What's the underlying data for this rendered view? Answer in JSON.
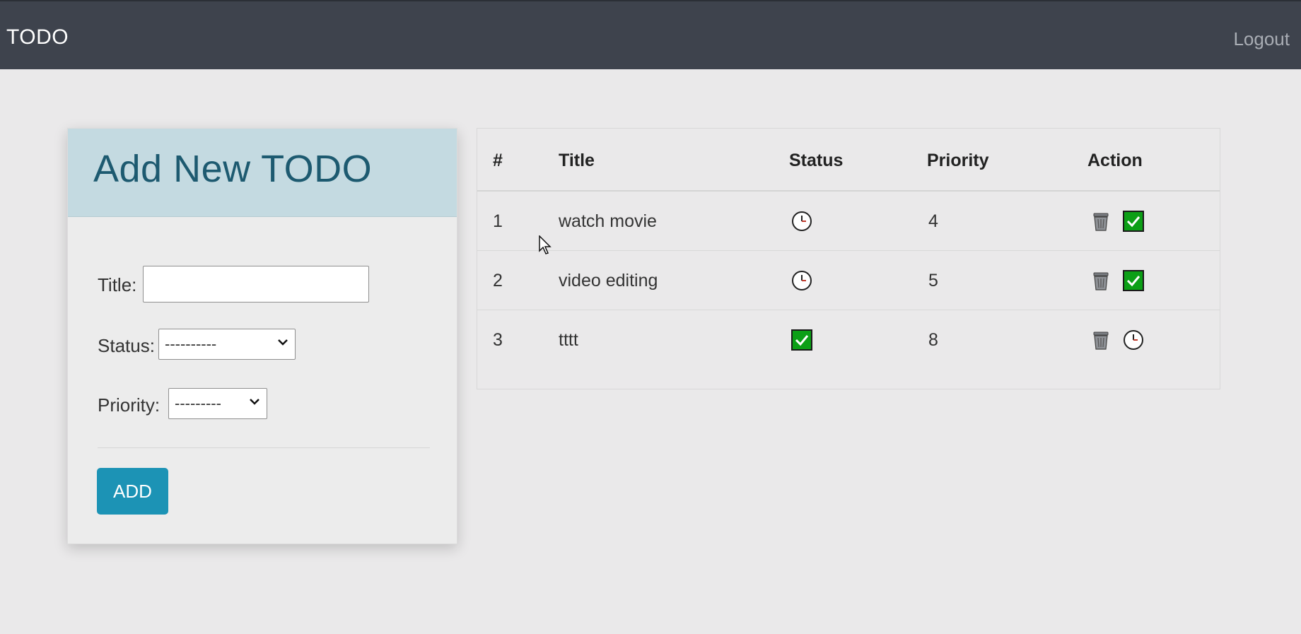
{
  "nav": {
    "brand": "TODO",
    "logout": "Logout",
    "bg_color": "#3e434d"
  },
  "form": {
    "heading": "Add New TODO",
    "title_label": "Title:",
    "title_value": "",
    "status_label": "Status:",
    "status_selected": "----------",
    "priority_label": "Priority:",
    "priority_selected": "---------",
    "add_button": "ADD",
    "header_color": "#c4dae1",
    "button_color": "#1c93b5"
  },
  "table": {
    "headers": [
      "#",
      "Title",
      "Status",
      "Priority",
      "Action"
    ],
    "rows": [
      {
        "num": "1",
        "title": "watch movie",
        "status_icon": "clock-icon",
        "priority": "4",
        "actions": [
          "trash-icon",
          "check-icon"
        ]
      },
      {
        "num": "2",
        "title": "video editing",
        "status_icon": "clock-icon",
        "priority": "5",
        "actions": [
          "trash-icon",
          "check-icon"
        ]
      },
      {
        "num": "3",
        "title": "tttt",
        "status_icon": "check-icon",
        "priority": "8",
        "actions": [
          "trash-icon",
          "clock-icon"
        ]
      }
    ]
  }
}
